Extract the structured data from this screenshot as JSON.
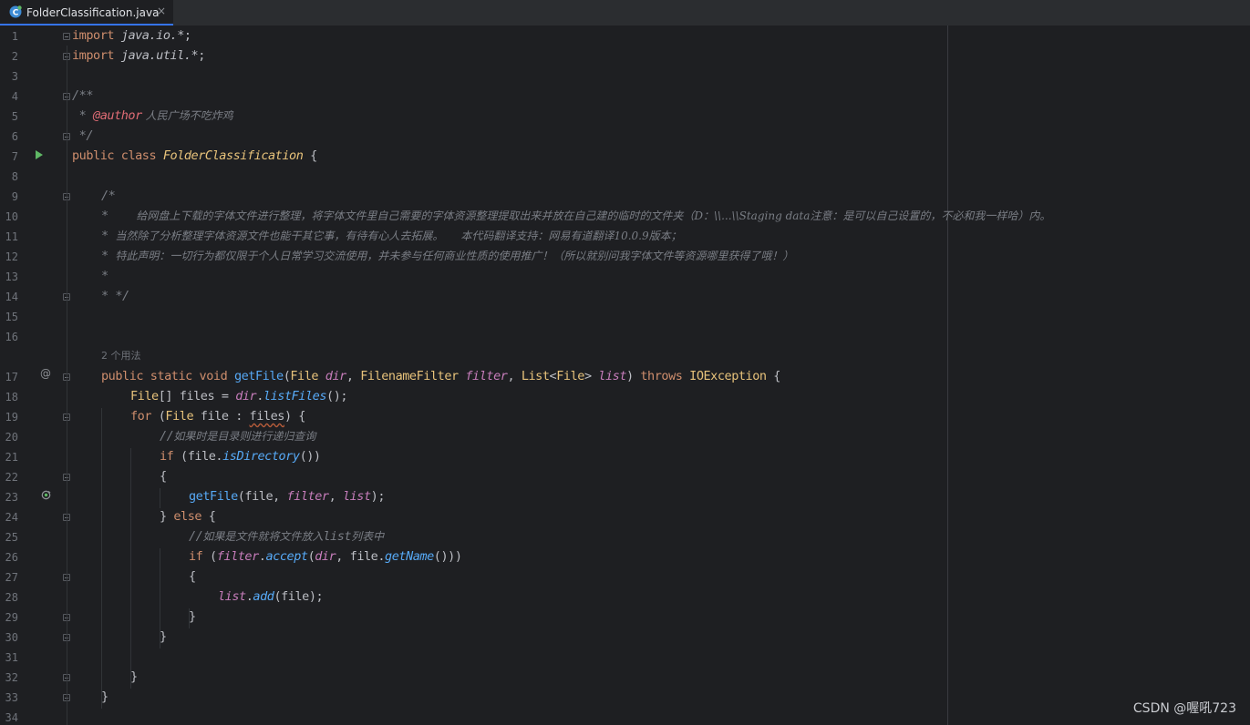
{
  "tab": {
    "filename": "FolderClassification.java",
    "close_glyph": "×"
  },
  "lines": [
    {
      "n": "1"
    },
    {
      "n": "2"
    },
    {
      "n": "3"
    },
    {
      "n": "4"
    },
    {
      "n": "5"
    },
    {
      "n": "6"
    },
    {
      "n": "7"
    },
    {
      "n": "8"
    },
    {
      "n": "9"
    },
    {
      "n": "10"
    },
    {
      "n": "11"
    },
    {
      "n": "12"
    },
    {
      "n": "13"
    },
    {
      "n": "14"
    },
    {
      "n": "15"
    },
    {
      "n": "16"
    },
    {
      "n": "17"
    },
    {
      "n": "18"
    },
    {
      "n": "19"
    },
    {
      "n": "20"
    },
    {
      "n": "21"
    },
    {
      "n": "22"
    },
    {
      "n": "23"
    },
    {
      "n": "24"
    },
    {
      "n": "25"
    },
    {
      "n": "26"
    },
    {
      "n": "27"
    },
    {
      "n": "28"
    },
    {
      "n": "29"
    },
    {
      "n": "30"
    },
    {
      "n": "31"
    },
    {
      "n": "32"
    },
    {
      "n": "33"
    },
    {
      "n": "34"
    }
  ],
  "code": {
    "l1": {
      "kw": "import",
      "pkg": "java.io.",
      "star": "*",
      "end": ";"
    },
    "l2": {
      "kw": "import",
      "pkg": "java.util.",
      "star": "*",
      "end": ";"
    },
    "l4": {
      "text": "/**"
    },
    "l5": {
      "star": " * ",
      "tag": "@author",
      "author": " 人民广场不吃炸鸡"
    },
    "l6": {
      "text": " */"
    },
    "l7": {
      "kw1": "public",
      "kw2": "class",
      "name": "FolderClassification",
      "brace": " {"
    },
    "l9": {
      "text": "/*"
    },
    "l10": {
      "star": "*    ",
      "text": "给网盘上下载的字体文件进行整理，将字体文件里自己需要的字体资源整理提取出来并放在自己建的临时的文件夹（D：\\\\...\\\\Staging data注意：是可以自己设置的，不必和我一样哈）内。"
    },
    "l11": {
      "star": "* ",
      "text": "当然除了分析整理字体资源文件也能干其它事，有待有心人去拓展。     本代码翻译支持：网易有道翻译10.0.9版本；"
    },
    "l12": {
      "star": "* ",
      "text": "特此声明：一切行为都仅限于个人日常学习交流使用，并未参与任何商业性质的使用推广！（所以就别问我字体文件等资源哪里获得了哦！）"
    },
    "l13": {
      "text": "*"
    },
    "l14": {
      "text": "* */"
    },
    "hint17": "2 个用法",
    "l17": {
      "kw1": "public",
      "kw2": "static",
      "kw3": "void",
      "fn": "getFile",
      "t1": "File",
      "p1": "dir",
      "t2": "FilenameFilter",
      "p2": "filter",
      "t3": "List",
      "t3g": "File",
      "p3": "list",
      "kw4": "throws",
      "ex": "IOException"
    },
    "l18": {
      "type": "File",
      "rest1": "[] files = ",
      "p": "dir",
      "dot": ".",
      "call": "listFiles",
      "end": "();"
    },
    "l19": {
      "kw": "for",
      "open": " (",
      "type": "File",
      "var": " file : ",
      "warn": "files",
      "close": ") {"
    },
    "l20": {
      "slashes": "//",
      "text": "如果时是目录则进行递归查询"
    },
    "l21": {
      "kw": "if",
      "open": " (file.",
      "call": "isDirectory",
      "end": "())"
    },
    "l22": {
      "text": "{"
    },
    "l23": {
      "call": "getFile",
      "open": "(file, ",
      "p1": "filter",
      "comma": ", ",
      "p2": "list",
      "end": ");"
    },
    "l24": {
      "close": "} ",
      "kw": "else",
      "brace": " {"
    },
    "l25": {
      "slashes": "//",
      "text1": "如果是文件就将文件放入",
      "mono": "list",
      "text2": "列表中"
    },
    "l26": {
      "kw": "if",
      "open": " (",
      "p1": "filter",
      "dot1": ".",
      "call1": "accept",
      "open2": "(",
      "p2": "dir",
      "mid": ", file.",
      "call2": "getName",
      "end": "()))"
    },
    "l27": {
      "text": "{"
    },
    "l28": {
      "p": "list",
      "dot": ".",
      "call": "add",
      "end": "(file);"
    },
    "l29": {
      "text": "}"
    },
    "l30": {
      "text": "}"
    },
    "l32": {
      "text": "}"
    },
    "l33": {
      "text": "}"
    }
  },
  "gutter_icons": {
    "run": "run-icon",
    "override": "@",
    "recursion": "recursion-icon"
  },
  "watermark": "CSDN @喔吼723"
}
